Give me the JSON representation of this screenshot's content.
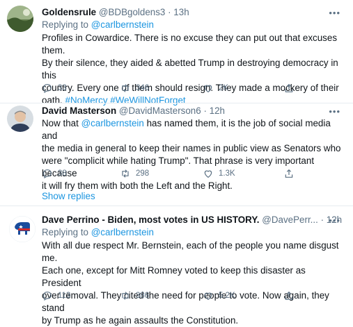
{
  "tweets": [
    {
      "name": "Goldensrule",
      "handle": "@BDBgoldens3",
      "dot": "·",
      "time": "13h",
      "replying_prefix": "Replying to ",
      "replying_to": "@carlbernstein",
      "lines": [
        [
          {
            "t": "Profiles in Cowardice. There is no excuse they can put out that excuses them."
          }
        ],
        [
          {
            "t": "By their silence, they aided & abetted Trump in destroying democracy in this"
          }
        ],
        [
          {
            "t": "country. Every one of them should resign. They made a mockery of their"
          }
        ],
        [
          {
            "t": "oath. "
          },
          {
            "t": "#NoMercy #WeWillNotForget",
            "link": true
          }
        ]
      ],
      "replies": "33",
      "retweets": "346",
      "likes": "2K"
    },
    {
      "name": "David Masterson",
      "handle": "@DavidMasterson6",
      "dot": "·",
      "time": "12h",
      "lines": [
        [
          {
            "t": "Now that "
          },
          {
            "t": "@carlbernstein",
            "link": true
          },
          {
            "t": " has named them, it is the job of social media and"
          }
        ],
        [
          {
            "t": "the media in general to keep their names in public view as Senators who"
          }
        ],
        [
          {
            "t": "were \"complicit while hating Trump\". That phrase is very important because"
          }
        ],
        [
          {
            "t": "it will fry them with both the Left and the Right."
          }
        ]
      ],
      "replies": "38",
      "retweets": "298",
      "likes": "1.3K",
      "show_replies": "Show replies"
    },
    {
      "name": "Dave Perrino - Biden, most votes in US HISTORY.",
      "handle": "@DavePerr...",
      "dot": "·",
      "time": "12h",
      "replying_prefix": "Replying to ",
      "replying_to": "@carlbernstein",
      "lines": [
        [
          {
            "t": "With all due respect Mr. Bernstein, each of the people you name disgust me."
          }
        ],
        [
          {
            "t": "Each one, except for Mitt Romney voted to keep this disaster as President"
          }
        ],
        [
          {
            "t": "over removal. They cited the need for people to vote. Now again, they stand"
          }
        ],
        [
          {
            "t": "by Trump as he again assaults the Constitution."
          }
        ]
      ],
      "replies": "113",
      "retweets": "386",
      "likes": "5.2K"
    }
  ],
  "icons": {
    "more": "more-icon",
    "reply": "reply-icon",
    "retweet": "retweet-icon",
    "like": "like-icon",
    "share": "share-icon"
  },
  "colors": {
    "link": "#1b95e0",
    "muted": "#5b7083",
    "text": "#0f1419",
    "divider": "#e6ecf0"
  },
  "more_label": "•••"
}
